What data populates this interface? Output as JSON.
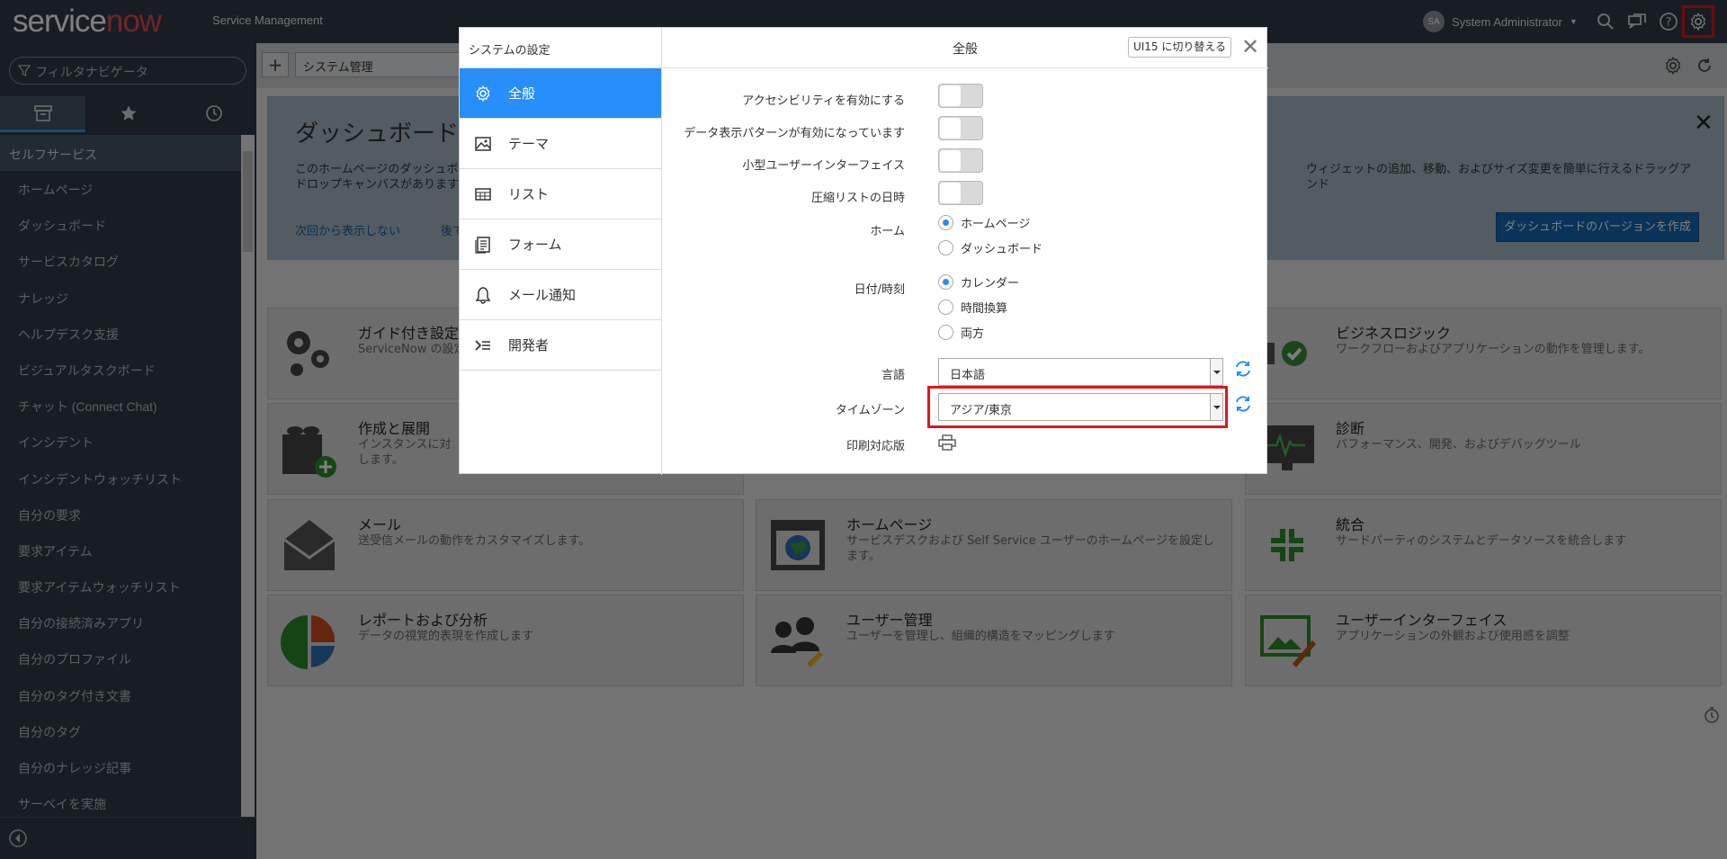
{
  "topbar": {
    "logo_service": "service",
    "logo_now": "now",
    "product": "Service Management",
    "user_initials": "SA",
    "user_name": "System Administrator",
    "icons": [
      "search-icon",
      "chat-icon",
      "help-icon",
      "gear-icon"
    ]
  },
  "sidebar": {
    "filter_placeholder": "フィルタナビゲータ",
    "tabs": [
      "all-apps-icon",
      "favorites-star-icon",
      "history-clock-icon"
    ],
    "section": "セルフサービス",
    "items": [
      "ホームページ",
      "ダッシュボード",
      "サービスカタログ",
      "ナレッジ",
      "ヘルプデスク支援",
      "ビジュアルタスクボード",
      "チャット (Connect Chat)",
      "インシデント",
      "インシデントウォッチリスト",
      "自分の要求",
      "要求アイテム",
      "要求アイテムウォッチリスト",
      "自分の接続済みアプリ",
      "自分のプロファイル",
      "自分のタグ付き文書",
      "自分のタグ",
      "自分のナレッジ記事",
      "サーベイを実施"
    ]
  },
  "main": {
    "tab_title": "システム管理",
    "banner": {
      "title": "ダッシュボードを",
      "desc_left": "このホームページのダッシュボ",
      "desc_right": "ウィジェットの追加、移動、およびサイズ変更を簡単に行えるドラッグアンド",
      "desc_line2": "ドロップキャンバスがあります",
      "link1": "次回から表示しない",
      "link2": "後で",
      "button": "ダッシュボードのバージョンを作成"
    },
    "cards": [
      {
        "title": "ガイド付き設定",
        "desc": "ServiceNow の設定",
        "icon": "gears-icon"
      },
      {
        "title": "ビジネスロジック",
        "desc": "ワークフローおよびアプリケーションの動作を管理します。",
        "icon": "business-logic-icon"
      },
      {
        "title": "作成と展開",
        "desc": "インスタンスに対\nします。",
        "icon": "create-deploy-icon"
      },
      {
        "title": "診断",
        "desc": "パフォーマンス、開発、およびデバッグツール",
        "icon": "diagnostics-monitor-icon"
      },
      {
        "title": "メール",
        "desc": "送受信メールの動作をカスタマイズします。",
        "icon": "mail-envelope-icon"
      },
      {
        "title": "ホームページ",
        "desc": "サービスデスクおよび Self Service ユーザーのホームページを設定します。",
        "icon": "homepage-globe-icon"
      },
      {
        "title": "統合",
        "desc": "サードパーティのシステムとデータソースを統合します",
        "icon": "integration-arrows-icon"
      },
      {
        "title": "レポートおよび分析",
        "desc": "データの視覚的表現を作成します",
        "icon": "pie-chart-icon"
      },
      {
        "title": "ユーザー管理",
        "desc": "ユーザーを管理し、組織的構造をマッピングします",
        "icon": "users-icon"
      },
      {
        "title": "ユーザーインターフェイス",
        "desc": "アプリケーションの外観および使用感を調整",
        "icon": "ui-paint-icon"
      }
    ]
  },
  "modal": {
    "left_title": "システムの設定",
    "menu": [
      {
        "label": "全般",
        "icon": "gear-icon",
        "active": true
      },
      {
        "label": "テーマ",
        "icon": "image-icon",
        "active": false
      },
      {
        "label": "リスト",
        "icon": "list-icon",
        "active": false
      },
      {
        "label": "フォーム",
        "icon": "form-icon",
        "active": false
      },
      {
        "label": "メール通知",
        "icon": "bell-icon",
        "active": false
      },
      {
        "label": "開発者",
        "icon": "developer-icon",
        "active": false
      }
    ],
    "title": "全般",
    "switch_btn": "UI15 に切り替える",
    "settings": {
      "accessibility": "アクセシビリティを有効にする",
      "data_pattern": "データ表示パターンが有効になっています",
      "compact_ui": "小型ユーザーインターフェイス",
      "compact_list_date": "圧縮リストの日時",
      "home_label": "ホーム",
      "home_opt1": "ホームページ",
      "home_opt2": "ダッシュボード",
      "datetime_label": "日付/時刻",
      "dt_opt1": "カレンダー",
      "dt_opt2": "時間換算",
      "dt_opt3": "両方",
      "language_label": "言語",
      "language_value": "日本語",
      "timezone_label": "タイムゾーン",
      "timezone_value": "アジア/東京",
      "print_label": "印刷対応版"
    },
    "toggles": {
      "accessibility": false,
      "data_pattern": false,
      "compact_ui": false,
      "compact_list_date": false
    },
    "selected": {
      "home": "ホームページ",
      "datetime": "カレンダー"
    }
  },
  "colors": {
    "topbar": "#303a46",
    "accent_blue": "#278efc",
    "highlight_red": "#e0161c",
    "brand_now": "#e34a4a"
  }
}
